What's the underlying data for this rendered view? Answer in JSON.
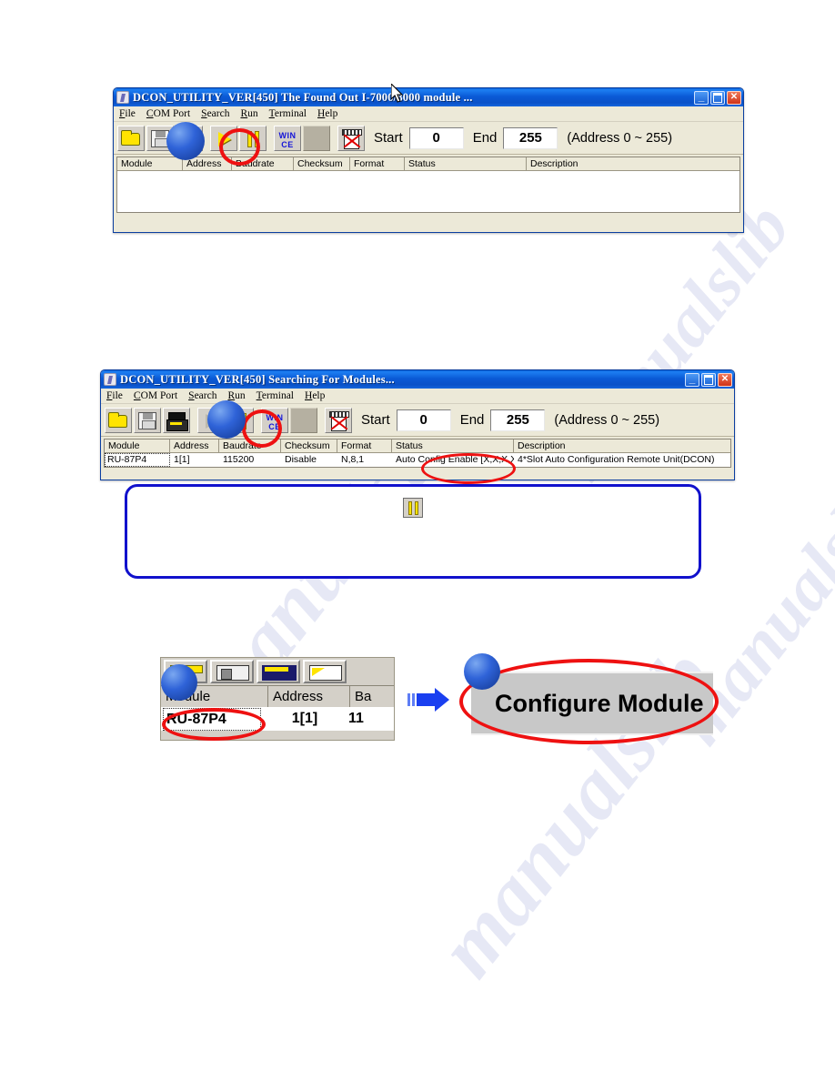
{
  "document": {
    "background_color": "#ffffff",
    "watermark_text": "manualslib"
  },
  "window1": {
    "title": "DCON_UTILITY_VER[450] The Found Out I-7000/8000 module ...",
    "menu": [
      {
        "label": "File",
        "accel": "F"
      },
      {
        "label": "COM Port",
        "accel": "C"
      },
      {
        "label": "Search",
        "accel": "S"
      },
      {
        "label": "Run",
        "accel": "R"
      },
      {
        "label": "Terminal",
        "accel": "T"
      },
      {
        "label": "Help",
        "accel": "H"
      }
    ],
    "toolbar": [
      {
        "name": "open-folder-icon",
        "label": "Open"
      },
      {
        "name": "save-floppy-icon",
        "label": "Save"
      },
      {
        "name": "print-icon",
        "label": "Print"
      },
      {
        "name": "run-play-icon",
        "label": "Start Search"
      },
      {
        "name": "stop-pause-icon",
        "label": "Stop Search"
      },
      {
        "name": "wince-icon",
        "label": "WIN CE"
      },
      {
        "name": "blank-button-icon",
        "label": ""
      },
      {
        "name": "terminal-disabled-icon",
        "label": "Terminal"
      }
    ],
    "wince_line1": "WIN",
    "wince_line2": "CE",
    "range": {
      "start_label": "Start",
      "start_value": "0",
      "end_label": "End",
      "end_value": "255",
      "note": "(Address 0 ~ 255)"
    },
    "grid": {
      "columns": [
        "Module",
        "Address",
        "Baudrate",
        "Checksum",
        "Format",
        "Status",
        "Description"
      ],
      "rows": []
    },
    "window_buttons": {
      "minimize": "_",
      "maximize": "□",
      "close": "✕"
    }
  },
  "window2": {
    "title": "DCON_UTILITY_VER[450] Searching For Modules...",
    "menu": [
      {
        "label": "File",
        "accel": "F"
      },
      {
        "label": "COM Port",
        "accel": "C"
      },
      {
        "label": "Search",
        "accel": "S"
      },
      {
        "label": "Run",
        "accel": "R"
      },
      {
        "label": "Terminal",
        "accel": "T"
      },
      {
        "label": "Help",
        "accel": "H"
      }
    ],
    "wince_line1": "WIN",
    "wince_line2": "CE",
    "range": {
      "start_label": "Start",
      "start_value": "0",
      "end_label": "End",
      "end_value": "255",
      "note": "(Address 0 ~ 255)"
    },
    "grid": {
      "columns": [
        "Module",
        "Address",
        "Baudrate",
        "Checksum",
        "Format",
        "Status",
        "Description"
      ],
      "row": {
        "module": "RU-87P4",
        "address": "1[1]",
        "baudrate": "115200",
        "checksum": "Disable",
        "format": "N,8,1",
        "status": "Auto Config Enable [X,X,X,X]",
        "description": "4*Slot Auto Configuration Remote Unit(DCON)"
      }
    },
    "window_buttons": {
      "minimize": "_",
      "maximize": "□",
      "close": "✕"
    }
  },
  "callout": {
    "border_color": "#1111cc",
    "icon_name": "pause-icon",
    "text": ""
  },
  "zoom_panel_left": {
    "columns": [
      "Module",
      "Address",
      "Ba"
    ],
    "module_value": "RU-87P4",
    "address_value": "1[1]",
    "baudrate_value": "11"
  },
  "zoom_panel_right": {
    "title": "Configure Module"
  },
  "annotations": {
    "ellipse_color": "#ee1111",
    "dot_color": "#2f63d8",
    "arrow_color": "#1a3ff0",
    "markers": [
      {
        "name": "marker-dot-run-button"
      },
      {
        "name": "marker-dot-stop-button"
      },
      {
        "name": "marker-dot-module-column"
      },
      {
        "name": "marker-dot-configure-module"
      }
    ]
  }
}
